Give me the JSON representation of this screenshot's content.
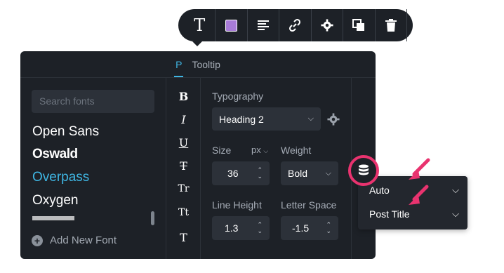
{
  "toolbar": {
    "buttons": [
      {
        "name": "text-icon",
        "glyph": "T"
      },
      {
        "name": "color-swatch-icon",
        "color": "#a87bd8"
      },
      {
        "name": "align-left-icon"
      },
      {
        "name": "link-icon"
      },
      {
        "name": "gear-icon"
      },
      {
        "name": "duplicate-icon"
      },
      {
        "name": "trash-icon"
      }
    ]
  },
  "tabs": {
    "p": "P",
    "tooltip": "Tooltip"
  },
  "fonts": {
    "search_placeholder": "Search fonts",
    "items": [
      "Open Sans",
      "Oswald",
      "Overpass",
      "Oxygen"
    ],
    "selected": "Overpass",
    "add_label": "Add New Font"
  },
  "styles": [
    "B",
    "I",
    "U",
    "T",
    "Tr",
    "Tt",
    "T"
  ],
  "typography": {
    "label": "Typography",
    "value": "Heading 2"
  },
  "size": {
    "label": "Size",
    "unit": "px",
    "value": "36"
  },
  "weight": {
    "label": "Weight",
    "value": "Bold"
  },
  "line_height": {
    "label": "Line Height",
    "value": "1.3"
  },
  "letter_space": {
    "label": "Letter Space",
    "value": "-1.5"
  },
  "dynamic_dropdown": {
    "rows": [
      "Auto",
      "Post Title"
    ]
  },
  "colors": {
    "accent": "#3fb6e3",
    "highlight": "#e9336f",
    "panel": "#1d2127"
  }
}
